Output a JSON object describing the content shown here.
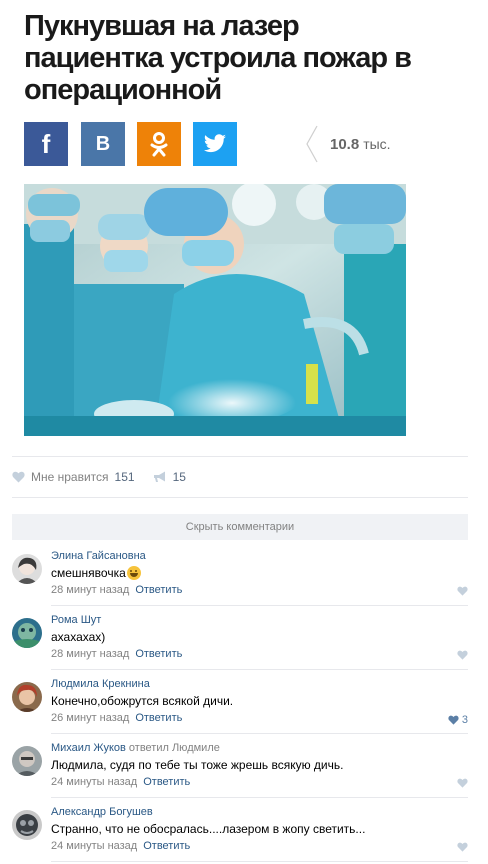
{
  "article": {
    "title": "Пукнувшая на лазер пациентка устроила пожар в операционной",
    "share_count": "10.8",
    "share_count_unit": "тыс.",
    "share_buttons": [
      {
        "label": "f",
        "icon": "facebook-icon",
        "color": "#3b5998"
      },
      {
        "label": "B",
        "icon": "vk-icon",
        "color": "#4a76a8"
      },
      {
        "label": "",
        "icon": "odnoklassniki-icon",
        "color": "#ee8208"
      },
      {
        "label": "",
        "icon": "twitter-icon",
        "color": "#1da1f2"
      }
    ]
  },
  "post_actions": {
    "like_label": "Мне нравится",
    "like_count": "151",
    "share_count": "15"
  },
  "comments_toggle": "Скрыть комментарии",
  "comments": [
    {
      "author": "Элина Гайсановна",
      "reply_to": "",
      "text": "смешнявочка",
      "has_emoji": true,
      "time": "28 минут назад",
      "reply_label": "Ответить",
      "likes": ""
    },
    {
      "author": "Рома Шут",
      "reply_to": "",
      "text": "ахахахах)",
      "has_emoji": false,
      "time": "28 минут назад",
      "reply_label": "Ответить",
      "likes": ""
    },
    {
      "author": "Людмила Крекнина",
      "reply_to": "",
      "text": "Конечно,обожрутся всякой дичи.",
      "has_emoji": false,
      "time": "26 минут назад",
      "reply_label": "Ответить",
      "likes": "3"
    },
    {
      "author": "Михаил Жуков",
      "reply_to": "ответил Людмиле",
      "text": "Людмила, судя по тебе ты тоже жрешь всякую дичь.",
      "has_emoji": false,
      "time": "24 минуты назад",
      "reply_label": "Ответить",
      "likes": ""
    },
    {
      "author": "Александр Богушев",
      "reply_to": "",
      "text": "Странно, что не обосралась....лазером в жопу светить...",
      "has_emoji": false,
      "time": "24 минуты назад",
      "reply_label": "Ответить",
      "likes": ""
    }
  ],
  "colors": {
    "link": "#2a5885",
    "muted": "#828282",
    "divider": "#e7e8ec"
  }
}
